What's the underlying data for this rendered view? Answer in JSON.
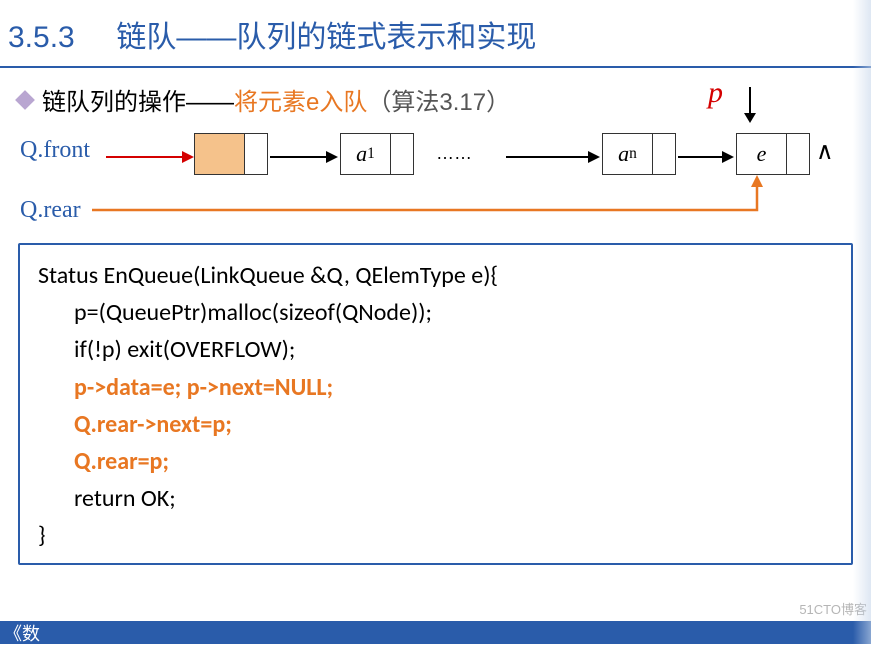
{
  "section": {
    "number": "3.5.3",
    "title": "链队——队列的链式表示和实现"
  },
  "bullet": {
    "prefix": "链队列的操作——",
    "highlight": "将元素e入队",
    "suffix": "（算法3.17）"
  },
  "diagram": {
    "p_label": "p",
    "qfront": "Q.front",
    "qrear": "Q.rear",
    "node1": "a",
    "node1_sub": "1",
    "dots": "……",
    "noden": "a",
    "noden_sub": "n",
    "nodee": "e",
    "null_sym": "∧"
  },
  "code": {
    "l1": "Status EnQueue(LinkQueue &Q, QElemType e){",
    "l2": "p=(QueuePtr)malloc(sizeof(QNode));",
    "l3": "if(!p) exit(OVERFLOW);",
    "l4": "p->data=e; p->next=NULL;",
    "l5": "Q.rear->next=p;",
    "l6": "Q.rear=p;",
    "l7": "return OK;",
    "l8": "}"
  },
  "footer": "《数",
  "watermark": "51CTO博客"
}
